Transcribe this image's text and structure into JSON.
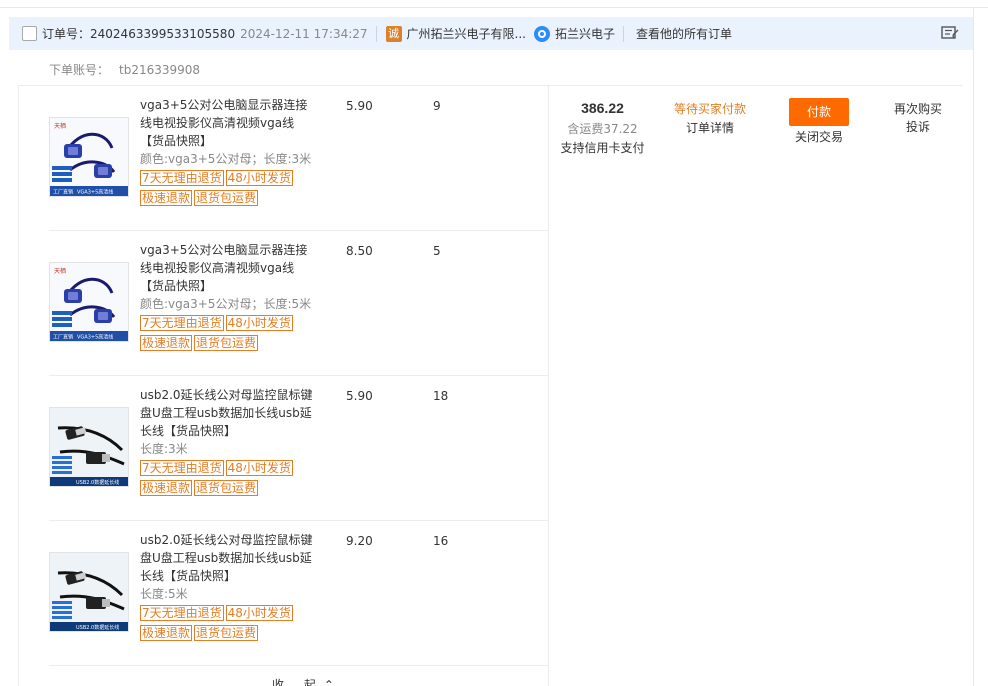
{
  "order": {
    "label": "订单号：",
    "number": "2402463399533105580",
    "time": "2024-12-11 17:34:27",
    "shop_icon_char": "诚",
    "shop_name": "广州拓兰兴电子有限...",
    "wangwang_name": "拓兰兴电子",
    "all_orders": "查看他的所有订单",
    "account_label": "下单账号：",
    "account_value": "tb216339908"
  },
  "items": [
    {
      "title": "vga3+5公对公电脑显示器连接线电视投影仪高清视频vga线",
      "snapshot": "【货品快照】",
      "sku": "颜色:vga3+5公对母；长度:3米",
      "price": "5.90",
      "qty": "9",
      "tags": [
        "7天无理由退货",
        "48小时发货",
        "极速退款",
        "退货包运费"
      ],
      "thumb_type": "vga",
      "thumb_caption": "VGA3+5高清线",
      "thumb_badge": "工厂直销",
      "thumb_brand": "天栖"
    },
    {
      "title": "vga3+5公对公电脑显示器连接线电视投影仪高清视频vga线",
      "snapshot": "【货品快照】",
      "sku": "颜色:vga3+5公对母；长度:5米",
      "price": "8.50",
      "qty": "5",
      "tags": [
        "7天无理由退货",
        "48小时发货",
        "极速退款",
        "退货包运费"
      ],
      "thumb_type": "vga",
      "thumb_caption": "VGA3+5高清线",
      "thumb_badge": "工厂直销",
      "thumb_brand": "天栖"
    },
    {
      "title": "usb2.0延长线公对母监控鼠标键盘U盘工程usb数据加长线usb延长线",
      "snapshot": "【货品快照】",
      "sku": "长度:3米",
      "price": "5.90",
      "qty": "18",
      "tags": [
        "7天无理由退货",
        "48小时发货",
        "极速退款",
        "退货包运费"
      ],
      "thumb_type": "usb",
      "thumb_caption": "USB2.0数据延长线",
      "thumb_badge": "",
      "thumb_brand": ""
    },
    {
      "title": "usb2.0延长线公对母监控鼠标键盘U盘工程usb数据加长线usb延长线",
      "snapshot": "【货品快照】",
      "sku": "长度:5米",
      "price": "9.20",
      "qty": "16",
      "tags": [
        "7天无理由退货",
        "48小时发货",
        "极速退款",
        "退货包运费"
      ],
      "thumb_type": "usb",
      "thumb_caption": "USB2.0数据延长线",
      "thumb_badge": "",
      "thumb_brand": ""
    }
  ],
  "total": {
    "amount": "386.22",
    "shipping": "含运费37.22",
    "credit": "支持信用卡支付"
  },
  "status": {
    "text": "等待买家付款",
    "detail": "订单详情"
  },
  "actions": {
    "pay": "付款",
    "close": "关闭交易",
    "rebuy": "再次购买",
    "complain": "投诉"
  },
  "collapse_label": "收 起",
  "colors": {
    "accent": "#ff6a00",
    "tag": "#e27e24",
    "header_bg": "#eaf3fd"
  },
  "icons": [
    "checkbox",
    "shop-cert-icon",
    "wangwang-icon",
    "message-icon",
    "chevron-up-icon"
  ]
}
